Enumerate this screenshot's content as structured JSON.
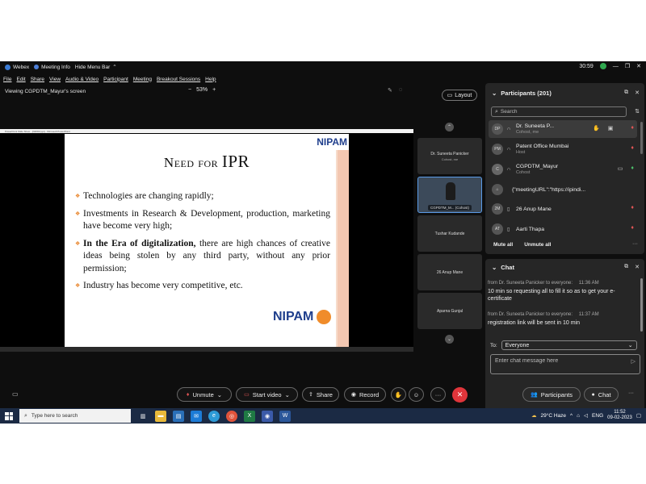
{
  "colors": {
    "accent": "#5a9ae6",
    "leave": "#e0353b",
    "mute_red": "#e05555",
    "mute_green": "#4cbf6a",
    "slide_logo": "#1f3e8c",
    "slide_bullet": "#e8852c"
  },
  "titlebar": {
    "app": "Webex",
    "meeting_info": "Meeting Info",
    "hide_menu": "Hide Menu Bar",
    "timer": "30:59",
    "min": "—",
    "restore": "❐",
    "close": "✕"
  },
  "menu": [
    "File",
    "Edit",
    "Share",
    "View",
    "Audio & Video",
    "Participant",
    "Meeting",
    "Breakout Sessions",
    "Help"
  ],
  "viewbar": {
    "label": "Viewing CGPDTM_Mayur's screen",
    "minus": "−",
    "zoom": "53%",
    "plus": "+"
  },
  "layout_btn": {
    "label": "Layout"
  },
  "slide": {
    "window_title": "PowerPoint Slide Show - [NiPAM.ppt] - Microsoft PowerPoint",
    "title_small": "Need for ",
    "title_big": "IPR",
    "logo": "NIPAM",
    "logo_bottom": "NIPAM",
    "bullet1": "Technologies are changing rapidly;",
    "bullet2": "Investments in Research & Development, production, marketing have become very high;",
    "bullet3_bold": "In the Era of digitalization,",
    "bullet3_rest": " there are high chances of creative ideas being stolen by any third party, without any prior permission;",
    "bullet4": "Industry has become very competitive, etc."
  },
  "videos": [
    {
      "name": "Dr. Suneeta Panicker",
      "role": "Cohost, me"
    },
    {
      "name": "CGPDTM_M... (Cohost)"
    },
    {
      "name": "Tushar Kudande"
    },
    {
      "name": "26 Anup Mane"
    },
    {
      "name": "Aparna Gunjal"
    }
  ],
  "participants": {
    "title": "Participants (201)",
    "search_placeholder": "Search",
    "list": [
      {
        "initials": "DP",
        "name": "Dr. Suneeta P...",
        "role": "Cohost, me"
      },
      {
        "initials": "PM",
        "name": "Patent Office Mumbai",
        "role": "Host"
      },
      {
        "initials": "C",
        "name": "CGPDTM_Mayur",
        "role": "Cohost"
      },
      {
        "initials": "",
        "name": "{\"meetingURL\":\"https://ipindi..."
      },
      {
        "initials": "2M",
        "name": "26 Anup Mane"
      },
      {
        "initials": "AT",
        "name": "Aarti Thapa"
      }
    ],
    "mute_all": "Mute all",
    "unmute_all": "Unmute all",
    "more": "···"
  },
  "chat": {
    "title": "Chat",
    "messages": [
      {
        "from": "from Dr. Suneeta Panicker to everyone:",
        "time": "11:36 AM",
        "text": "10 min so requesting all to fill it so as to get your e-certificate"
      },
      {
        "from": "from Dr. Suneeta Panicker to everyone:",
        "time": "11:37 AM",
        "text": "registration link will be sent in 10 min"
      }
    ],
    "to_label": "To:",
    "to_value": "Everyone",
    "input_placeholder": "Enter chat message here"
  },
  "controls": {
    "unmute": "Unmute",
    "start_video": "Start video",
    "share": "Share",
    "record": "Record",
    "participants": "Participants",
    "chat": "Chat",
    "more": "···"
  },
  "taskbar": {
    "search_placeholder": "Type here to search",
    "weather": "29°C  Haze",
    "lang": "ENG",
    "time": "11:52",
    "date": "09-02-2023"
  }
}
